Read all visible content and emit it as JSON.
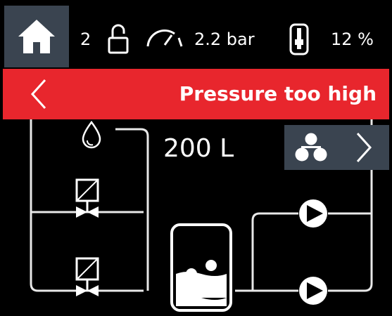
{
  "statusbar": {
    "home_icon": "home-icon",
    "user_level": "2",
    "lock_icon": "unlocked-padlock-icon",
    "gauge_icon": "pressure-gauge-icon",
    "pressure": "2.2 bar",
    "tank_icon": "tank-level-icon",
    "level": "12 %"
  },
  "alarm": {
    "back_icon": "chevron-left-icon",
    "message": "Pressure too high",
    "color": "#e8262d"
  },
  "diagram": {
    "volume": "200 L",
    "water_icon": "water-drop-icon",
    "valves": [
      "solenoid-valve-icon",
      "solenoid-valve-icon"
    ],
    "tank_icon": "tank-icon",
    "pumps": [
      "pump-icon",
      "pump-icon"
    ]
  },
  "next_panel": {
    "icon": "pump-group-icon",
    "chevron": "chevron-right-icon"
  },
  "colors": {
    "panel": "#3a4450",
    "line": "#e8e8e8",
    "background": "#000000"
  }
}
